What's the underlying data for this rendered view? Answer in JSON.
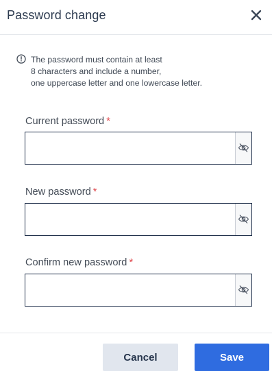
{
  "dialog": {
    "title": "Password change",
    "close_icon": "close-icon"
  },
  "notice": {
    "icon": "info-icon",
    "lines": [
      "The password must contain at least",
      "8 characters and include a number,",
      "one uppercase letter and one lowercase letter."
    ]
  },
  "fields": [
    {
      "label": "Current password",
      "required_marker": "*",
      "value": "",
      "toggle_icon": "eye-off-icon"
    },
    {
      "label": "New password",
      "required_marker": "*",
      "value": "",
      "toggle_icon": "eye-off-icon"
    },
    {
      "label": "Confirm new password",
      "required_marker": "*",
      "value": "",
      "toggle_icon": "eye-off-icon"
    }
  ],
  "footer": {
    "cancel_label": "Cancel",
    "save_label": "Save"
  },
  "colors": {
    "primary": "#2f6ce0",
    "required": "#e0474c",
    "field_border": "#1f2f4a",
    "cancel_bg": "#e1e6ee"
  }
}
